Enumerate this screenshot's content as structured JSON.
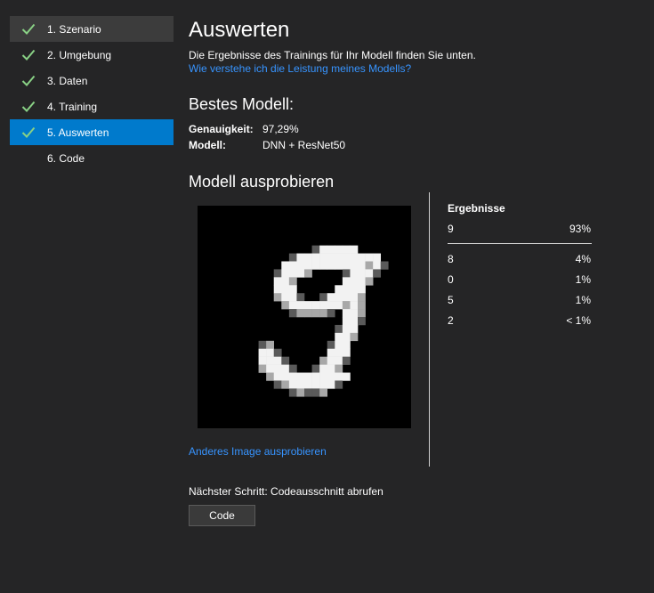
{
  "sidebar": {
    "items": [
      {
        "label": "1. Szenario",
        "done": true,
        "state": "hover"
      },
      {
        "label": "2. Umgebung",
        "done": true,
        "state": "normal"
      },
      {
        "label": "3. Daten",
        "done": true,
        "state": "normal"
      },
      {
        "label": "4. Training",
        "done": true,
        "state": "normal"
      },
      {
        "label": "5. Auswerten",
        "done": true,
        "state": "active"
      },
      {
        "label": "6. Code",
        "done": false,
        "state": "normal"
      }
    ]
  },
  "main": {
    "title": "Auswerten",
    "description": "Die Ergebnisse des Trainings für Ihr Modell finden Sie unten.",
    "help_link": "Wie verstehe ich die Leistung meines Modells?",
    "best_model": {
      "heading": "Bestes Modell:",
      "accuracy_label": "Genauigkeit:",
      "accuracy_value": "97,29%",
      "model_label": "Modell:",
      "model_value": "DNN + ResNet50"
    },
    "try_model": {
      "heading": "Modell ausprobieren",
      "other_image_link": "Anderes Image ausprobieren"
    },
    "results": {
      "title": "Ergebnisse",
      "top": {
        "label": "9",
        "pct": "93%"
      },
      "others": [
        {
          "label": "8",
          "pct": "4%"
        },
        {
          "label": "0",
          "pct": "1%"
        },
        {
          "label": "5",
          "pct": "1%"
        },
        {
          "label": "2",
          "pct": "< 1%"
        }
      ]
    },
    "next_step": "Nächster Schritt: Codeausschnitt abrufen",
    "code_button": "Code"
  },
  "colors": {
    "background": "#252526",
    "accent": "#007acc",
    "link": "#3794ff",
    "check": "#89d185"
  },
  "icons": {
    "check": "check-icon"
  }
}
